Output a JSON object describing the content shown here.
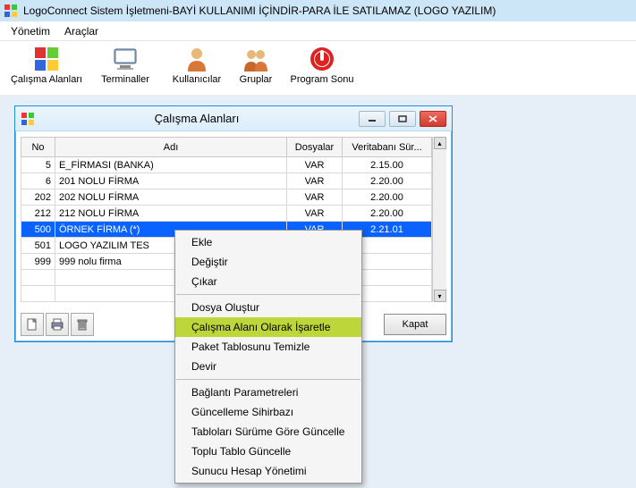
{
  "window": {
    "title": "LogoConnect Sistem İşletmeni-BAYİ KULLANIMI İÇİNDİR-PARA İLE SATILAMAZ (LOGO YAZILIM)"
  },
  "menubar": {
    "items": [
      "Yönetim",
      "Araçlar"
    ]
  },
  "toolbar": {
    "items": [
      {
        "label": "Çalışma Alanları",
        "icon": "workspaces-icon"
      },
      {
        "label": "Terminaller",
        "icon": "terminals-icon"
      },
      {
        "label": "Kullanıcılar",
        "icon": "users-icon"
      },
      {
        "label": "Gruplar",
        "icon": "groups-icon"
      },
      {
        "label": "Program Sonu",
        "icon": "exit-icon"
      }
    ]
  },
  "child_window": {
    "title": "Çalışma Alanları",
    "columns": {
      "no": "No",
      "name": "Adı",
      "files": "Dosyalar",
      "version": "Veritabanı Sür..."
    },
    "rows": [
      {
        "no": "5",
        "name": "E_FİRMASI (BANKA)",
        "files": "VAR",
        "version": "2.15.00"
      },
      {
        "no": "6",
        "name": "201 NOLU FİRMA",
        "files": "VAR",
        "version": "2.20.00"
      },
      {
        "no": "202",
        "name": "202 NOLU FİRMA",
        "files": "VAR",
        "version": "2.20.00"
      },
      {
        "no": "212",
        "name": "212 NOLU FİRMA",
        "files": "VAR",
        "version": "2.20.00"
      },
      {
        "no": "500",
        "name": "ÖRNEK FİRMA (*)",
        "files": "VAR",
        "version": "2.21.01",
        "selected": true
      },
      {
        "no": "501",
        "name": "LOGO YAZILIM TES",
        "files": "",
        "version": ""
      },
      {
        "no": "999",
        "name": "999 nolu firma",
        "files": "",
        "version": ""
      },
      {
        "no": "",
        "name": "",
        "files": "",
        "version": ""
      },
      {
        "no": "",
        "name": "",
        "files": "",
        "version": ""
      }
    ],
    "close_button": "Kapat"
  },
  "context_menu": {
    "items": [
      {
        "label": "Ekle"
      },
      {
        "label": "Değiştir"
      },
      {
        "label": "Çıkar"
      },
      {
        "sep": true
      },
      {
        "label": "Dosya Oluştur"
      },
      {
        "label": "Çalışma Alanı Olarak İşaretle",
        "highlight": true
      },
      {
        "label": "Paket Tablosunu Temizle"
      },
      {
        "label": "Devir"
      },
      {
        "sep": true
      },
      {
        "label": "Bağlantı Parametreleri"
      },
      {
        "label": "Güncelleme Sihirbazı"
      },
      {
        "label": "Tabloları Sürüme Göre Güncelle"
      },
      {
        "label": "Toplu Tablo Güncelle"
      },
      {
        "label": "Sunucu Hesap Yönetimi"
      }
    ]
  }
}
